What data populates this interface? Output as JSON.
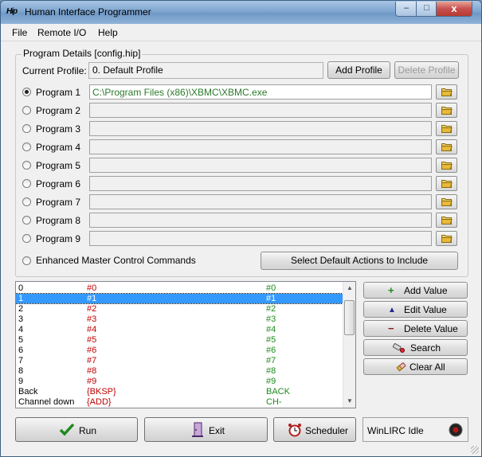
{
  "window": {
    "icon_text": "Hip",
    "title": "Human Interface Programmer",
    "min_glyph": "–",
    "max_glyph": "□",
    "close_glyph": "x"
  },
  "menu": [
    {
      "label": "File"
    },
    {
      "label": "Remote I/O"
    },
    {
      "label": "Help"
    }
  ],
  "program_details": {
    "legend": "Program Details [config.hip]",
    "current_profile_label": "Current Profile:",
    "current_profile_value": "0. Default Profile",
    "add_profile": "Add Profile",
    "delete_profile": "Delete Profile",
    "programs": [
      {
        "label": "Program 1",
        "path": "C:\\Program Files (x86)\\XBMC\\XBMC.exe",
        "checked": true
      },
      {
        "label": "Program 2",
        "path": "",
        "checked": false
      },
      {
        "label": "Program 3",
        "path": "",
        "checked": false
      },
      {
        "label": "Program 4",
        "path": "",
        "checked": false
      },
      {
        "label": "Program 5",
        "path": "",
        "checked": false
      },
      {
        "label": "Program 6",
        "path": "",
        "checked": false
      },
      {
        "label": "Program 7",
        "path": "",
        "checked": false
      },
      {
        "label": "Program 8",
        "path": "",
        "checked": false
      },
      {
        "label": "Program 9",
        "path": "",
        "checked": false
      }
    ],
    "enhanced_label": "Enhanced Master Control Commands",
    "select_defaults": "Select Default Actions to Include"
  },
  "list": {
    "rows": [
      {
        "key": "0",
        "code": "#0",
        "action": "#0"
      },
      {
        "key": "1",
        "code": "#1",
        "action": "#1"
      },
      {
        "key": "2",
        "code": "#2",
        "action": "#2"
      },
      {
        "key": "3",
        "code": "#3",
        "action": "#3"
      },
      {
        "key": "4",
        "code": "#4",
        "action": "#4"
      },
      {
        "key": "5",
        "code": "#5",
        "action": "#5"
      },
      {
        "key": "6",
        "code": "#6",
        "action": "#6"
      },
      {
        "key": "7",
        "code": "#7",
        "action": "#7"
      },
      {
        "key": "8",
        "code": "#8",
        "action": "#8"
      },
      {
        "key": "9",
        "code": "#9",
        "action": "#9"
      },
      {
        "key": "Back",
        "code": "{BKSP}",
        "action": "BACK"
      },
      {
        "key": "Channel down",
        "code": "{ADD}",
        "action": "CH-"
      }
    ],
    "selected_index": 1
  },
  "actions": {
    "add_value": "Add Value",
    "edit_value": "Edit Value",
    "delete_value": "Delete Value",
    "search": "Search",
    "clear_all": "Clear All"
  },
  "footer": {
    "run": "Run",
    "exit": "Exit",
    "scheduler": "Scheduler",
    "status": "WinLIRC Idle"
  },
  "colors": {
    "path_text": "#2b7a2b",
    "code_text": "#c00000",
    "action_text": "#1f8a1f",
    "selection": "#3399ff"
  }
}
